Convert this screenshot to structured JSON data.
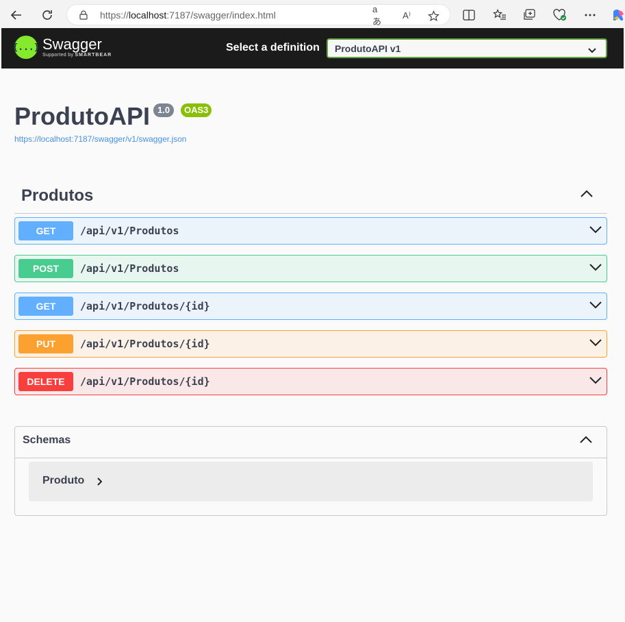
{
  "browser": {
    "url_prefix": "https://",
    "url_host": "localhost",
    "url_rest": ":7187/swagger/index.html",
    "read_aloud": "aあ",
    "reader": "A⁾"
  },
  "topbar": {
    "logo_name": "Swagger",
    "logo_glyph": "{...}",
    "logo_supported": "Supported by",
    "logo_brand": "SMARTBEAR",
    "select_label": "Select a definition",
    "select_value": "ProdutoAPI v1"
  },
  "info": {
    "title": "ProdutoAPI",
    "version": "1.0",
    "oas": "OAS3",
    "link": "https://localhost:7187/swagger/v1/swagger.json"
  },
  "tag": {
    "name": "Produtos",
    "operations": [
      {
        "method": "GET",
        "path": "/api/v1/Produtos"
      },
      {
        "method": "POST",
        "path": "/api/v1/Produtos"
      },
      {
        "method": "GET",
        "path": "/api/v1/Produtos/{id}"
      },
      {
        "method": "PUT",
        "path": "/api/v1/Produtos/{id}"
      },
      {
        "method": "DELETE",
        "path": "/api/v1/Produtos/{id}"
      }
    ]
  },
  "schemas": {
    "title": "Schemas",
    "models": [
      {
        "name": "Produto"
      }
    ]
  },
  "colors": {
    "get": "#61affe",
    "post": "#49cc90",
    "put": "#fca130",
    "delete": "#f93e3e",
    "swagger_green": "#85ea2d"
  }
}
